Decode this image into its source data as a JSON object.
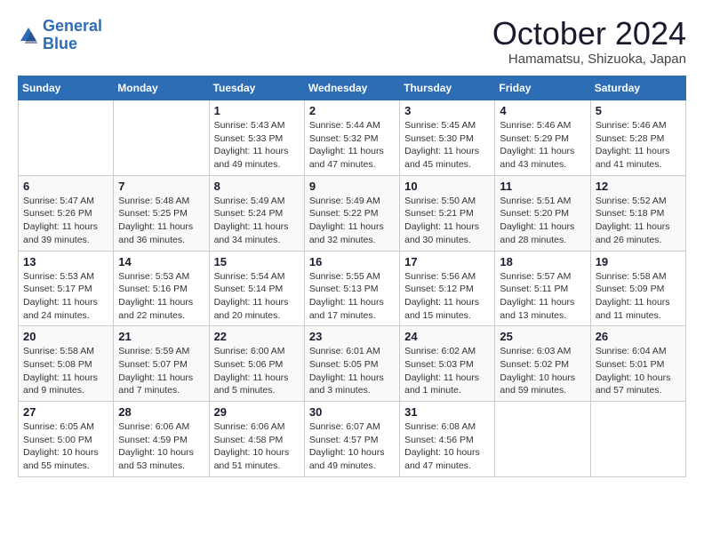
{
  "header": {
    "logo_line1": "General",
    "logo_line2": "Blue",
    "month": "October 2024",
    "location": "Hamamatsu, Shizuoka, Japan"
  },
  "days_of_week": [
    "Sunday",
    "Monday",
    "Tuesday",
    "Wednesday",
    "Thursday",
    "Friday",
    "Saturday"
  ],
  "weeks": [
    [
      {
        "day": "",
        "info": ""
      },
      {
        "day": "",
        "info": ""
      },
      {
        "day": "1",
        "info": "Sunrise: 5:43 AM\nSunset: 5:33 PM\nDaylight: 11 hours and 49 minutes."
      },
      {
        "day": "2",
        "info": "Sunrise: 5:44 AM\nSunset: 5:32 PM\nDaylight: 11 hours and 47 minutes."
      },
      {
        "day": "3",
        "info": "Sunrise: 5:45 AM\nSunset: 5:30 PM\nDaylight: 11 hours and 45 minutes."
      },
      {
        "day": "4",
        "info": "Sunrise: 5:46 AM\nSunset: 5:29 PM\nDaylight: 11 hours and 43 minutes."
      },
      {
        "day": "5",
        "info": "Sunrise: 5:46 AM\nSunset: 5:28 PM\nDaylight: 11 hours and 41 minutes."
      }
    ],
    [
      {
        "day": "6",
        "info": "Sunrise: 5:47 AM\nSunset: 5:26 PM\nDaylight: 11 hours and 39 minutes."
      },
      {
        "day": "7",
        "info": "Sunrise: 5:48 AM\nSunset: 5:25 PM\nDaylight: 11 hours and 36 minutes."
      },
      {
        "day": "8",
        "info": "Sunrise: 5:49 AM\nSunset: 5:24 PM\nDaylight: 11 hours and 34 minutes."
      },
      {
        "day": "9",
        "info": "Sunrise: 5:49 AM\nSunset: 5:22 PM\nDaylight: 11 hours and 32 minutes."
      },
      {
        "day": "10",
        "info": "Sunrise: 5:50 AM\nSunset: 5:21 PM\nDaylight: 11 hours and 30 minutes."
      },
      {
        "day": "11",
        "info": "Sunrise: 5:51 AM\nSunset: 5:20 PM\nDaylight: 11 hours and 28 minutes."
      },
      {
        "day": "12",
        "info": "Sunrise: 5:52 AM\nSunset: 5:18 PM\nDaylight: 11 hours and 26 minutes."
      }
    ],
    [
      {
        "day": "13",
        "info": "Sunrise: 5:53 AM\nSunset: 5:17 PM\nDaylight: 11 hours and 24 minutes."
      },
      {
        "day": "14",
        "info": "Sunrise: 5:53 AM\nSunset: 5:16 PM\nDaylight: 11 hours and 22 minutes."
      },
      {
        "day": "15",
        "info": "Sunrise: 5:54 AM\nSunset: 5:14 PM\nDaylight: 11 hours and 20 minutes."
      },
      {
        "day": "16",
        "info": "Sunrise: 5:55 AM\nSunset: 5:13 PM\nDaylight: 11 hours and 17 minutes."
      },
      {
        "day": "17",
        "info": "Sunrise: 5:56 AM\nSunset: 5:12 PM\nDaylight: 11 hours and 15 minutes."
      },
      {
        "day": "18",
        "info": "Sunrise: 5:57 AM\nSunset: 5:11 PM\nDaylight: 11 hours and 13 minutes."
      },
      {
        "day": "19",
        "info": "Sunrise: 5:58 AM\nSunset: 5:09 PM\nDaylight: 11 hours and 11 minutes."
      }
    ],
    [
      {
        "day": "20",
        "info": "Sunrise: 5:58 AM\nSunset: 5:08 PM\nDaylight: 11 hours and 9 minutes."
      },
      {
        "day": "21",
        "info": "Sunrise: 5:59 AM\nSunset: 5:07 PM\nDaylight: 11 hours and 7 minutes."
      },
      {
        "day": "22",
        "info": "Sunrise: 6:00 AM\nSunset: 5:06 PM\nDaylight: 11 hours and 5 minutes."
      },
      {
        "day": "23",
        "info": "Sunrise: 6:01 AM\nSunset: 5:05 PM\nDaylight: 11 hours and 3 minutes."
      },
      {
        "day": "24",
        "info": "Sunrise: 6:02 AM\nSunset: 5:03 PM\nDaylight: 11 hours and 1 minute."
      },
      {
        "day": "25",
        "info": "Sunrise: 6:03 AM\nSunset: 5:02 PM\nDaylight: 10 hours and 59 minutes."
      },
      {
        "day": "26",
        "info": "Sunrise: 6:04 AM\nSunset: 5:01 PM\nDaylight: 10 hours and 57 minutes."
      }
    ],
    [
      {
        "day": "27",
        "info": "Sunrise: 6:05 AM\nSunset: 5:00 PM\nDaylight: 10 hours and 55 minutes."
      },
      {
        "day": "28",
        "info": "Sunrise: 6:06 AM\nSunset: 4:59 PM\nDaylight: 10 hours and 53 minutes."
      },
      {
        "day": "29",
        "info": "Sunrise: 6:06 AM\nSunset: 4:58 PM\nDaylight: 10 hours and 51 minutes."
      },
      {
        "day": "30",
        "info": "Sunrise: 6:07 AM\nSunset: 4:57 PM\nDaylight: 10 hours and 49 minutes."
      },
      {
        "day": "31",
        "info": "Sunrise: 6:08 AM\nSunset: 4:56 PM\nDaylight: 10 hours and 47 minutes."
      },
      {
        "day": "",
        "info": ""
      },
      {
        "day": "",
        "info": ""
      }
    ]
  ]
}
